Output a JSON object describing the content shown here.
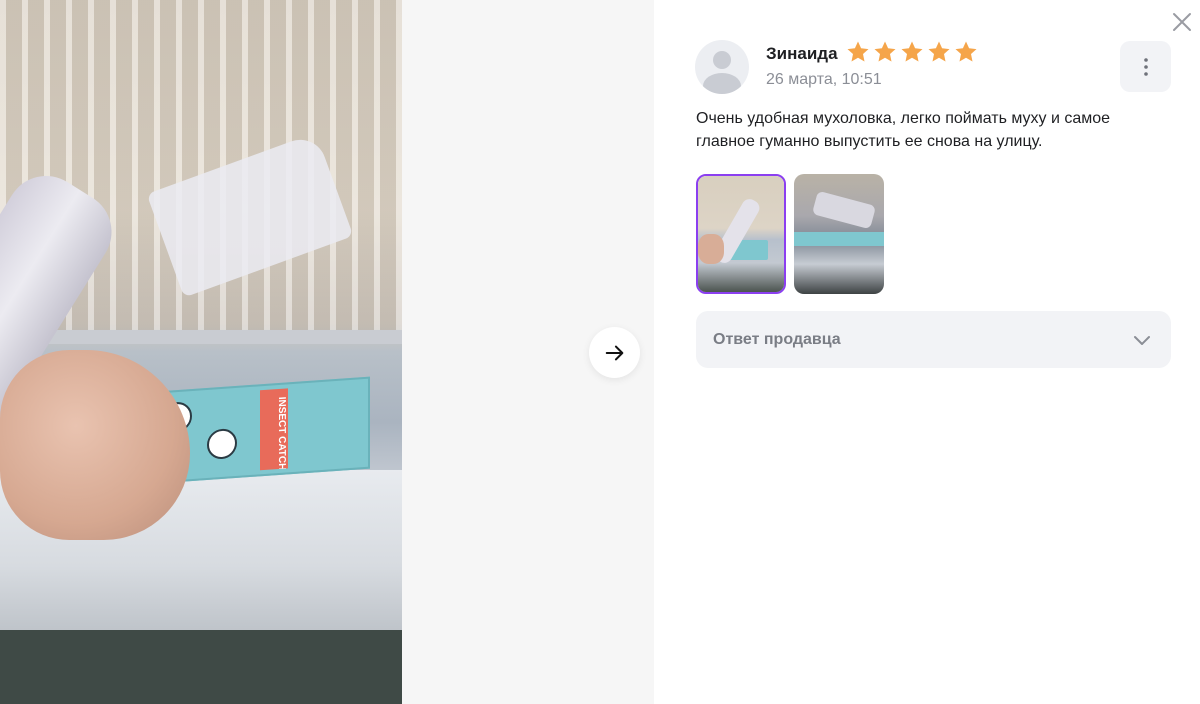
{
  "review": {
    "author": "Зинаида",
    "date": "26 марта, 10:51",
    "rating": 5,
    "text": "Очень удобная мухоловка, легко поймать муху и самое главное гуманно выпустить ее снова на улицу."
  },
  "photo": {
    "product_text": "INSECT CATCHER"
  },
  "seller_reply": {
    "label": "Ответ продавца"
  },
  "thumbnails": {
    "count": 2,
    "selected_index": 0
  },
  "colors": {
    "star": "#f5a54a",
    "selected_thumb_border": "#8b3ff0",
    "muted_text": "#8b8e96",
    "panel_bg": "#f2f3f6"
  },
  "icons": {
    "next": "arrow-right-icon",
    "close": "close-icon",
    "menu": "more-vertical-icon",
    "expand": "chevron-down-icon",
    "star": "star-icon",
    "avatar": "user-placeholder-icon"
  }
}
